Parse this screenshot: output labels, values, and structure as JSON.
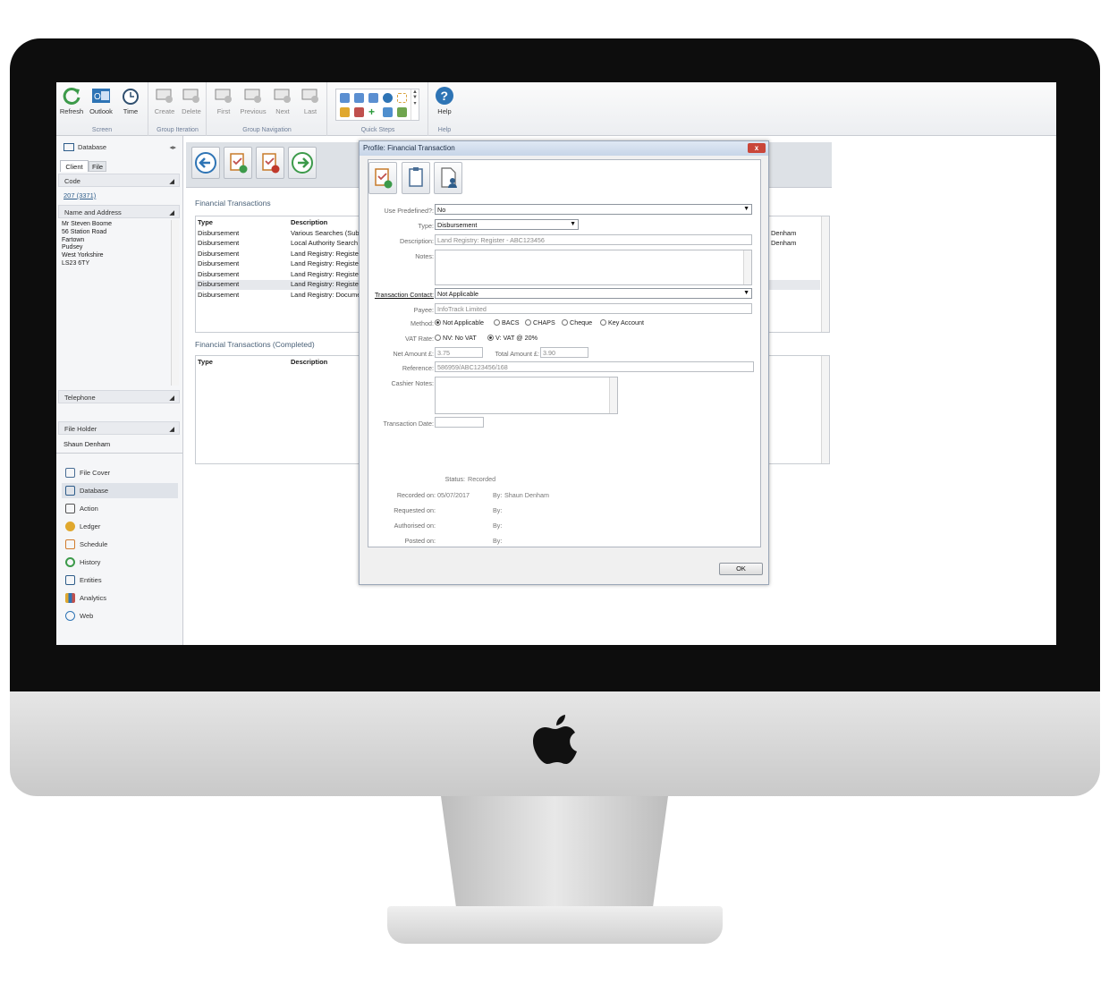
{
  "ribbon": {
    "groups": [
      {
        "label": "Screen",
        "buttons": [
          {
            "label": "Refresh",
            "icon": "refresh-icon"
          },
          {
            "label": "Outlook",
            "icon": "outlook-icon"
          },
          {
            "label": "Time",
            "icon": "clock-icon"
          }
        ]
      },
      {
        "label": "Group Iteration",
        "buttons": [
          {
            "label": "Create",
            "icon": "monitor-add-icon"
          },
          {
            "label": "Delete",
            "icon": "monitor-delete-icon"
          }
        ]
      },
      {
        "label": "Group Navigation",
        "buttons": [
          {
            "label": "First",
            "icon": "monitor-first-icon"
          },
          {
            "label": "Previous",
            "icon": "monitor-previous-icon"
          },
          {
            "label": "Next",
            "icon": "monitor-next-icon"
          },
          {
            "label": "Last",
            "icon": "monitor-last-icon"
          }
        ]
      },
      {
        "label": "Quick Steps"
      },
      {
        "label": "Help",
        "buttons": [
          {
            "label": "Help",
            "icon": "help-icon"
          }
        ]
      }
    ]
  },
  "left": {
    "header": "Database",
    "tabs": [
      "Client",
      "File"
    ],
    "code_label": "Code",
    "code_value": "207 (3371)",
    "address_label": "Name and Address",
    "address_lines": [
      "Mr Steven Boome",
      "56 Station Road",
      "Fartown",
      "Pudsey",
      "West Yorkshire",
      "LS23 6TY"
    ],
    "telephone_label": "Telephone",
    "file_holder_label": "File Holder",
    "file_holder_value": "Shaun Denham",
    "nav": [
      {
        "label": "File Cover",
        "icon": "file-cover-icon"
      },
      {
        "label": "Database",
        "icon": "database-icon"
      },
      {
        "label": "Action",
        "icon": "action-icon"
      },
      {
        "label": "Ledger",
        "icon": "ledger-icon"
      },
      {
        "label": "Schedule",
        "icon": "schedule-icon"
      },
      {
        "label": "History",
        "icon": "history-icon"
      },
      {
        "label": "Entities",
        "icon": "entities-icon"
      },
      {
        "label": "Analytics",
        "icon": "analytics-icon"
      },
      {
        "label": "Web",
        "icon": "globe-icon"
      }
    ]
  },
  "main": {
    "section1": "Financial Transactions",
    "section2": "Financial Transactions (Completed)",
    "col_type": "Type",
    "col_description": "Description",
    "rows": [
      {
        "type": "Disbursement",
        "description": "Various Searches (Subje",
        "right": "Denham"
      },
      {
        "type": "Disbursement",
        "description": "Local Authority Search",
        "right": "Denham"
      },
      {
        "type": "Disbursement",
        "description": "Land Registry: Register",
        "right": ""
      },
      {
        "type": "Disbursement",
        "description": "Land Registry: Register",
        "right": ""
      },
      {
        "type": "Disbursement",
        "description": "Land Registry: Register",
        "right": ""
      },
      {
        "type": "Disbursement",
        "description": "Land Registry: Register",
        "right": ""
      },
      {
        "type": "Disbursement",
        "description": "Land Registry: Documer",
        "right": ""
      }
    ]
  },
  "dialog": {
    "title": "Profile: Financial Transaction",
    "close": "x",
    "use_predefined_label": "Use Predefined?:",
    "use_predefined_value": "No",
    "type_label": "Type:",
    "type_value": "Disbursement",
    "description_label": "Description:",
    "description_value": "Land Registry: Register - ABC123456",
    "notes_label": "Notes:",
    "transaction_contact_label": "Transaction Contact:",
    "transaction_contact_value": "Not Applicable",
    "payee_label": "Payee:",
    "payee_value": "InfoTrack Limited",
    "method_label": "Method:",
    "methods": [
      "Not Applicable",
      "BACS",
      "CHAPS",
      "Cheque",
      "Key Account"
    ],
    "method_selected": "Not Applicable",
    "vat_label": "VAT Rate:",
    "vat_options": [
      "NV: No VAT",
      "V: VAT @ 20%"
    ],
    "vat_selected": "V: VAT @ 20%",
    "net_label": "Net Amount £:",
    "net_value": "3.75",
    "total_label": "Total Amount £:",
    "total_value": "3.90",
    "reference_label": "Reference:",
    "reference_value": "586959/ABC123456/168",
    "cashier_notes_label": "Cashier Notes:",
    "transaction_date_label": "Transaction Date:",
    "status_label": "Status:",
    "status_value": "Recorded",
    "recorded_label": "Recorded on:",
    "recorded_value": "05/07/2017",
    "requested_label": "Requested on:",
    "authorised_label": "Authorised on:",
    "posted_label": "Posted on:",
    "by_label": "By:",
    "recorded_by": "Shaun Denham",
    "ok_label": "OK"
  },
  "colors": {
    "accent": "#2e74b5",
    "ribbon_group_label": "#6f7f99",
    "section_text": "#4a6178"
  }
}
